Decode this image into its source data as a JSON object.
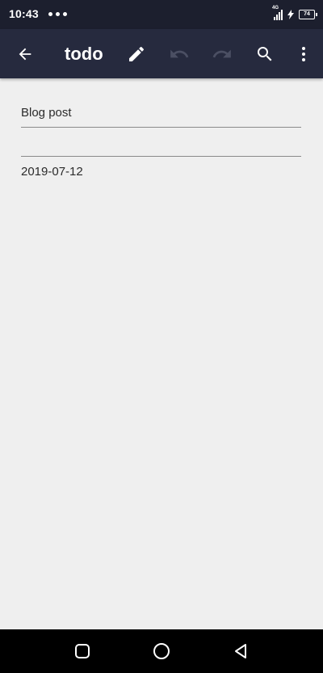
{
  "status_bar": {
    "time": "10:43",
    "network_label": "4G",
    "battery_level": "74"
  },
  "toolbar": {
    "title": "todo",
    "icons": [
      "back-arrow-icon",
      "pencil-icon",
      "undo-icon",
      "redo-icon",
      "search-icon",
      "more-vert-icon"
    ],
    "disabled_icon_color": "#4b4f63"
  },
  "note": {
    "title": "Blog post",
    "body": "",
    "date": "2019-07-12"
  },
  "navigation_bar": {
    "icons": [
      "recents-square-icon",
      "home-circle-icon",
      "back-triangle-icon"
    ]
  },
  "colors": {
    "toolbar": "#262a3e",
    "status_bar": "#1c1f2e",
    "background": "#efefef"
  }
}
